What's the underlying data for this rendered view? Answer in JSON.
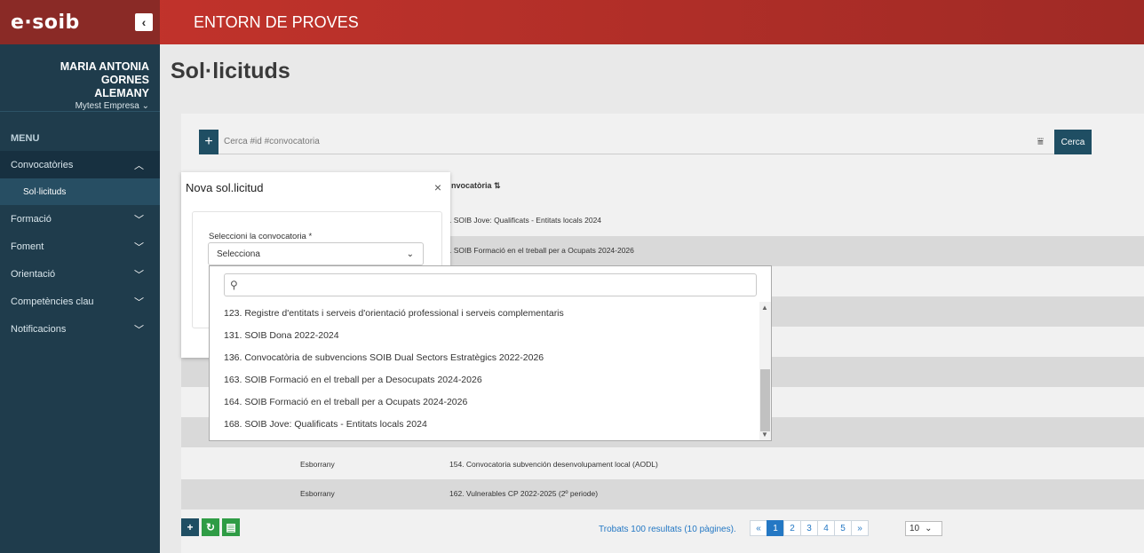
{
  "header": {
    "logo": "e·soib",
    "collapse_icon": "chevron-left-icon",
    "collapse_glyph": "‹",
    "environment": "ENTORN DE PROVES"
  },
  "user": {
    "name_line1": "MARIA ANTONIA GORNES",
    "name_line2": "ALEMANY",
    "company": "Mytest Empresa",
    "company_chevron": "⌄"
  },
  "sidebar": {
    "menu_label": "MENU",
    "chev_up": "︿",
    "chev_down": "﹀",
    "items": [
      {
        "label": "Convocatòries",
        "open": true
      },
      {
        "label": "Sol·licituds",
        "sub": true
      },
      {
        "label": "Formació"
      },
      {
        "label": "Foment"
      },
      {
        "label": "Orientació"
      },
      {
        "label": "Competències clau"
      },
      {
        "label": "Notificacions"
      }
    ]
  },
  "main": {
    "title": "Sol·licituds",
    "add_glyph": "+",
    "search_placeholder": "Cerca #id #convocatoria",
    "filter_glyph": "⩸",
    "search_button": "Cerca",
    "column_convocatoria": "nvocatòria ⇅"
  },
  "table": {
    "rows": [
      {
        "estat": "",
        "convocatoria": ". SOIB Jove: Qualificats - Entitats locals 2024",
        "alt": false
      },
      {
        "estat": "",
        "convocatoria": ". SOIB Formació en el treball per a Ocupats 2024-2026",
        "alt": true
      },
      {
        "estat": "Esborrany",
        "convocatoria": "154. Convocatoria subvención desenvolupament local (AODL)",
        "alt": false
      },
      {
        "estat": "Esborrany",
        "convocatoria": "162. Vulnerables CP 2022-2025 (2º periode)",
        "alt": true
      }
    ]
  },
  "footer": {
    "add_glyph": "+",
    "refresh_glyph": "↻",
    "export_glyph": "▤",
    "results": "Trobats 100 resultats (10 pàgines).",
    "pages": [
      "«",
      "1",
      "2",
      "3",
      "4",
      "5",
      "»"
    ],
    "active_page": "1",
    "page_size": "10",
    "page_size_chevron": "⌄"
  },
  "modal": {
    "title": "Nova sol.licitud",
    "close_glyph": "×",
    "field_label": "Seleccioni la convocatoria *",
    "select_value": "Selecciona",
    "select_chevron": "⌄"
  },
  "dropdown": {
    "search_glyph": "⚲",
    "scroll_up": "▲",
    "scroll_down": "▼",
    "options": [
      "123. Registre d'entitats i serveis d'orientació professional i serveis complementaris",
      "131. SOIB Dona 2022-2024",
      "136. Convocatòria de subvencions SOIB Dual Sectors Estratègics 2022-2026",
      "163. SOIB Formació en el treball per a Desocupats 2024-2026",
      "164. SOIB Formació en el treball per a Ocupats 2024-2026",
      "168. SOIB Jove: Qualificats - Entitats locals 2024"
    ]
  },
  "colors": {
    "header_red": "#c6342c",
    "sidebar_navy": "#1f3c4c",
    "button_navy": "#1f4e63",
    "button_green": "#2f9c45",
    "link_blue": "#2478c4"
  }
}
